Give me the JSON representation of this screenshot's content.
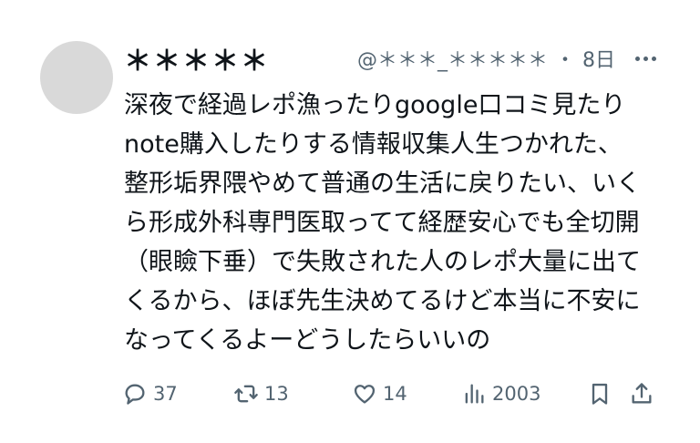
{
  "post": {
    "display_name": "＊＊＊＊＊",
    "handle": "@＊＊＊_＊＊＊＊＊",
    "separator": "・",
    "time": "8日",
    "text": "深夜で経過レポ漁ったりgoogle口コミ見たり\nnote購入したりする情報収集人生つかれた、\n整形垢界隈やめて普通の生活に戻りたい、いく\nら形成外科専門医取ってて経歴安心でも全切開\n（眼瞼下垂）で失敗された人のレポ大量に出て\nくるから、ほぼ先生決めてるけど本当に不安に\nなってくるよーどうしたらいいの"
  },
  "actions": {
    "reply_count": "37",
    "repost_count": "13",
    "like_count": "14",
    "view_count": "2003"
  },
  "icons": {
    "reply": "reply-icon",
    "repost": "repost-icon",
    "like": "heart-icon",
    "views": "views-icon",
    "bookmark": "bookmark-icon",
    "share": "share-icon",
    "more": "more-icon"
  },
  "colors": {
    "text": "#0f1419",
    "secondary": "#536471",
    "avatar": "#d9d9d9"
  }
}
